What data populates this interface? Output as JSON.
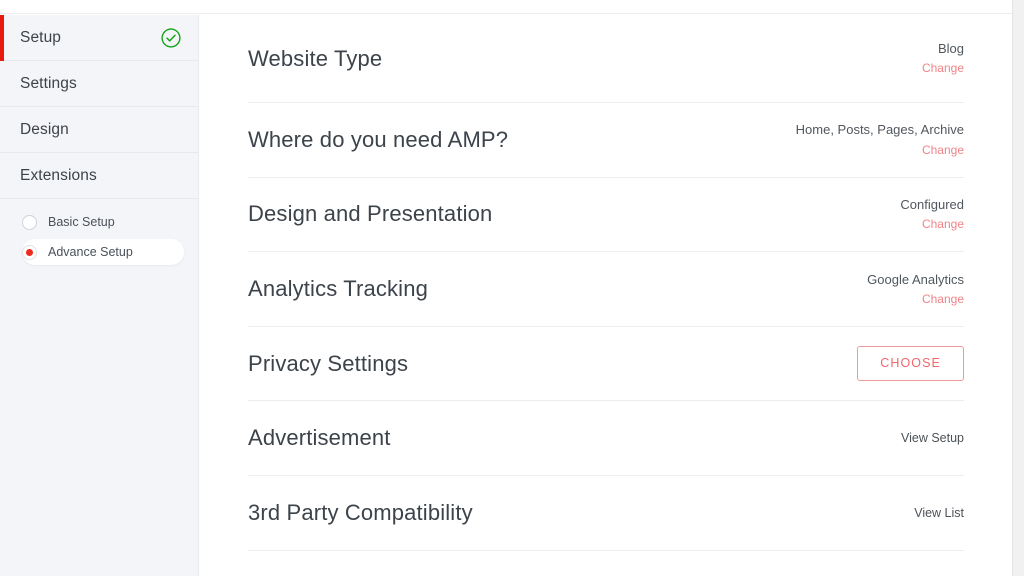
{
  "sidebar": {
    "items": [
      {
        "label": "Setup",
        "active": true,
        "icon": "check-circle-icon"
      },
      {
        "label": "Settings",
        "active": false,
        "icon": null
      },
      {
        "label": "Design",
        "active": false,
        "icon": null
      },
      {
        "label": "Extensions",
        "active": false,
        "icon": null
      }
    ],
    "options": [
      {
        "label": "Basic Setup",
        "selected": false
      },
      {
        "label": "Advance Setup",
        "selected": true
      }
    ]
  },
  "main": {
    "rows": [
      {
        "title": "Website Type",
        "value": "Blog",
        "action_label": "Change",
        "action_type": "link"
      },
      {
        "title": "Where do you need AMP?",
        "value": "Home, Posts, Pages, Archive",
        "action_label": "Change",
        "action_type": "link"
      },
      {
        "title": "Design and Presentation",
        "value": "Configured",
        "action_label": "Change",
        "action_type": "link"
      },
      {
        "title": "Analytics Tracking",
        "value": "Google Analytics",
        "action_label": "Change",
        "action_type": "link"
      },
      {
        "title": "Privacy Settings",
        "value": "",
        "action_label": "CHOOSE",
        "action_type": "button"
      },
      {
        "title": "Advertisement",
        "value": "",
        "action_label": "View Setup",
        "action_type": "plainlink"
      },
      {
        "title": "3rd Party Compatibility",
        "value": "",
        "action_label": "View List",
        "action_type": "plainlink"
      }
    ]
  },
  "colors": {
    "accent_red": "#e8190f",
    "link_red": "#f08488",
    "button_red": "#f0666b",
    "check_green": "#13a417",
    "sidebar_bg": "#f4f5f8",
    "title_text": "#3c434a"
  }
}
